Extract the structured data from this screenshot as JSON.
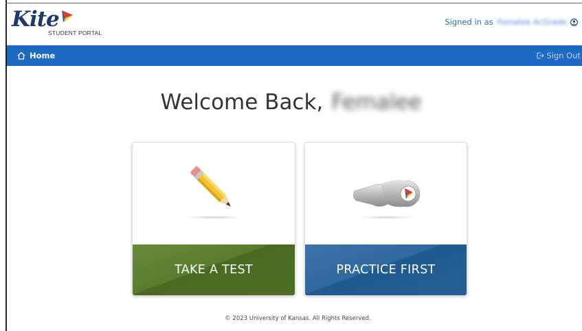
{
  "app": {
    "logo_text": "Kite",
    "logo_subtitle": "STUDENT PORTAL"
  },
  "header": {
    "signed_in_prefix": "Signed in as",
    "signed_in_name": "Femalee AcGrade"
  },
  "nav": {
    "home_label": "Home",
    "signout_label": "Sign Out"
  },
  "main": {
    "welcome_text": "Welcome Back,",
    "user_first_name": "Femalee"
  },
  "cards": [
    {
      "label": "TAKE A TEST",
      "icon": "pencil-icon",
      "color": "#597d2e"
    },
    {
      "label": "PRACTICE FIRST",
      "icon": "whistle-icon",
      "color": "#2f679f"
    }
  ],
  "footer": {
    "copyright": "© 2023 University of Kansas. All Rights Reserved."
  },
  "colors": {
    "nav_bar": "#1d6ac3",
    "brand_dark": "#1d3a6b",
    "link_blue": "#2a6cb6"
  }
}
